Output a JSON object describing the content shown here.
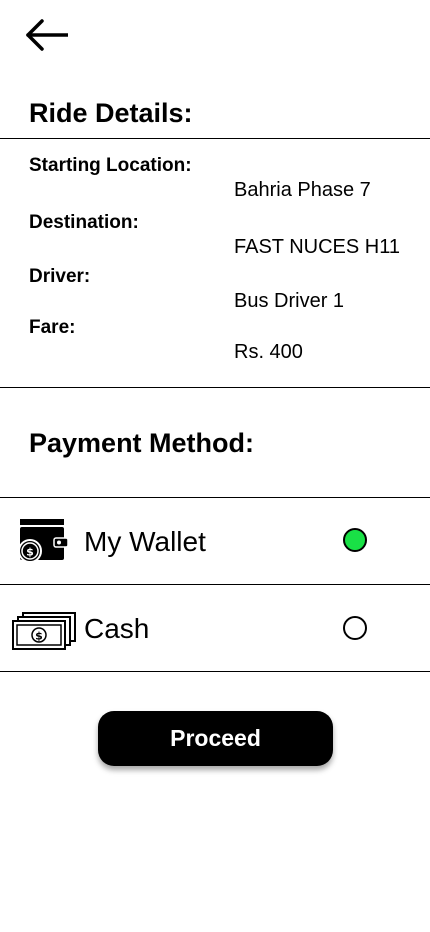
{
  "header": {
    "back_icon": "arrow-left-icon"
  },
  "ride_details": {
    "title": "Ride Details:",
    "starting_location_label": "Starting Location:",
    "starting_location_value": "Bahria Phase 7",
    "destination_label": "Destination:",
    "destination_value": "FAST NUCES H11",
    "driver_label": "Driver:",
    "driver_value": "Bus Driver 1",
    "fare_label": "Fare:",
    "fare_value": "Rs. 400"
  },
  "payment": {
    "title": "Payment Method:",
    "options": [
      {
        "label": "My Wallet",
        "icon": "wallet-icon",
        "selected": true
      },
      {
        "label": "Cash",
        "icon": "cash-icon",
        "selected": false
      }
    ],
    "selected_color": "#19e146"
  },
  "actions": {
    "proceed_label": "Proceed"
  }
}
